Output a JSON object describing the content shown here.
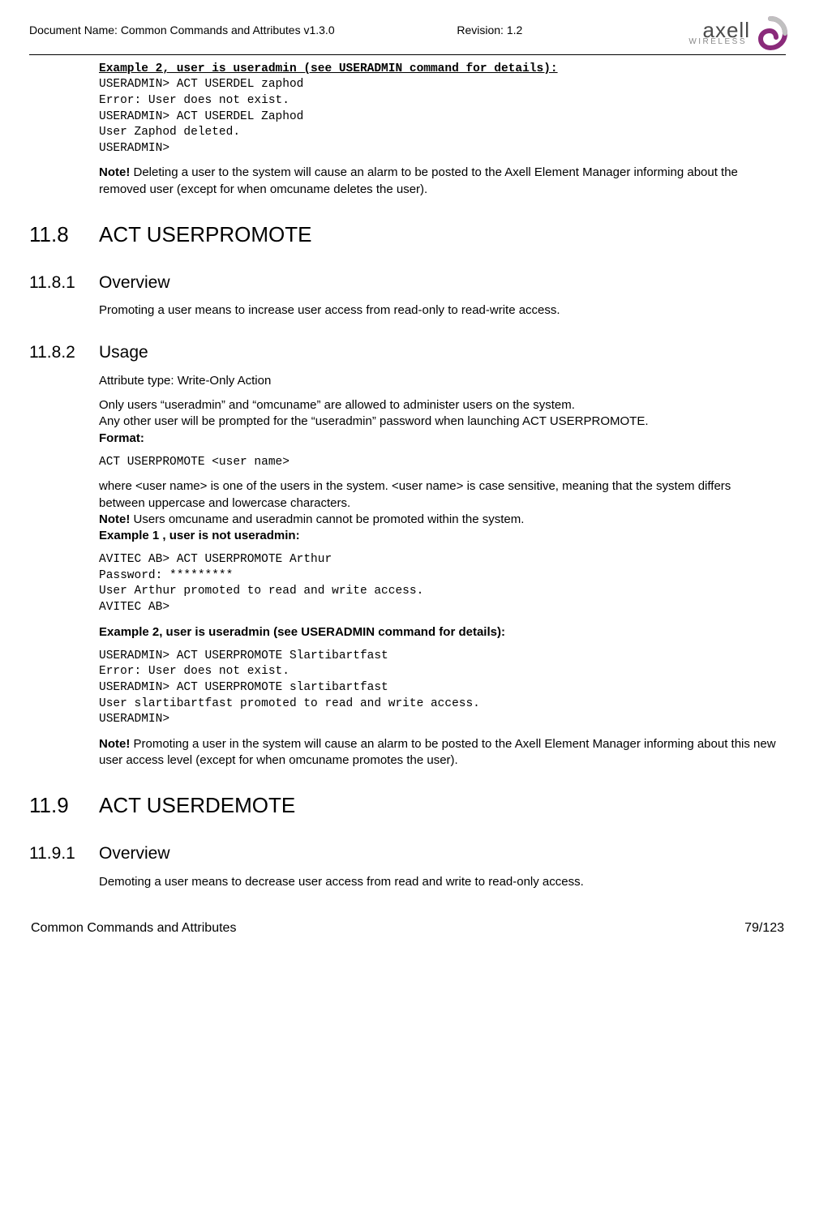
{
  "header": {
    "doc_name": "Document Name: Common Commands and Attributes v1.3.0",
    "revision": "Revision: 1.2",
    "logo_main": "axell",
    "logo_sub": "WIRELESS"
  },
  "ex2_header": "Example 2, user is useradmin (see USERADMIN command for details):",
  "ex2_code": "USERADMIN> ACT USERDEL zaphod\nError: User does not exist.\nUSERADMIN> ACT USERDEL Zaphod\nUser Zaphod deleted.\nUSERADMIN>",
  "note1_bold": "Note!",
  "note1_text": " Deleting a user to the system will cause an alarm to be posted to the Axell Element Manager informing about the removed user (except for when omcuname deletes the user).",
  "s118_num": "11.8",
  "s118_title": "ACT USERPROMOTE",
  "s1181_num": "11.8.1",
  "s1181_title": "Overview",
  "s1181_text": "Promoting a user means to increase user access from read-only to read-write access.",
  "s1182_num": "11.8.2",
  "s1182_title": "Usage",
  "s1182_attr": "Attribute type: Write-Only Action",
  "s1182_p1": "Only users “useradmin” and “omcuname” are allowed to administer users on the system.",
  "s1182_p2": "Any other user will be prompted for the “useradmin” password when launching ACT USERPROMOTE.",
  "s1182_format_label": "Format:",
  "s1182_format_code": "ACT USERPROMOTE <user name>",
  "s1182_where": "where <user name> is one of the users in the system. <user name> is case sensitive, meaning that the system differs between uppercase and lowercase characters.",
  "s1182_note_bold": "Note!",
  "s1182_note_text": " Users omcuname and useradmin cannot be promoted within the system.",
  "s1182_ex1_header": "Example 1 , user is not useradmin:",
  "s1182_ex1_code": "AVITEC AB> ACT USERPROMOTE Arthur\nPassword: *********\nUser Arthur promoted to read and write access.\nAVITEC AB>",
  "s1182_ex2_header": "Example 2, user is useradmin (see USERADMIN command for details):",
  "s1182_ex2_code": "USERADMIN> ACT USERPROMOTE Slartibartfast\nError: User does not exist.\nUSERADMIN> ACT USERPROMOTE slartibartfast\nUser slartibartfast promoted to read and write access.\nUSERADMIN>",
  "s1182_note2_bold": "Note!",
  "s1182_note2_text": " Promoting a user in the system will cause an alarm to be posted to the Axell Element Manager informing about this new user access level (except for when omcuname promotes the user).",
  "s119_num": "11.9",
  "s119_title": "ACT USERDEMOTE",
  "s1191_num": "11.9.1",
  "s1191_title": "Overview",
  "s1191_text": "Demoting a user means to decrease user access from read and write to read-only access.",
  "footer": {
    "left": "Common Commands and Attributes",
    "right": "79/123"
  }
}
